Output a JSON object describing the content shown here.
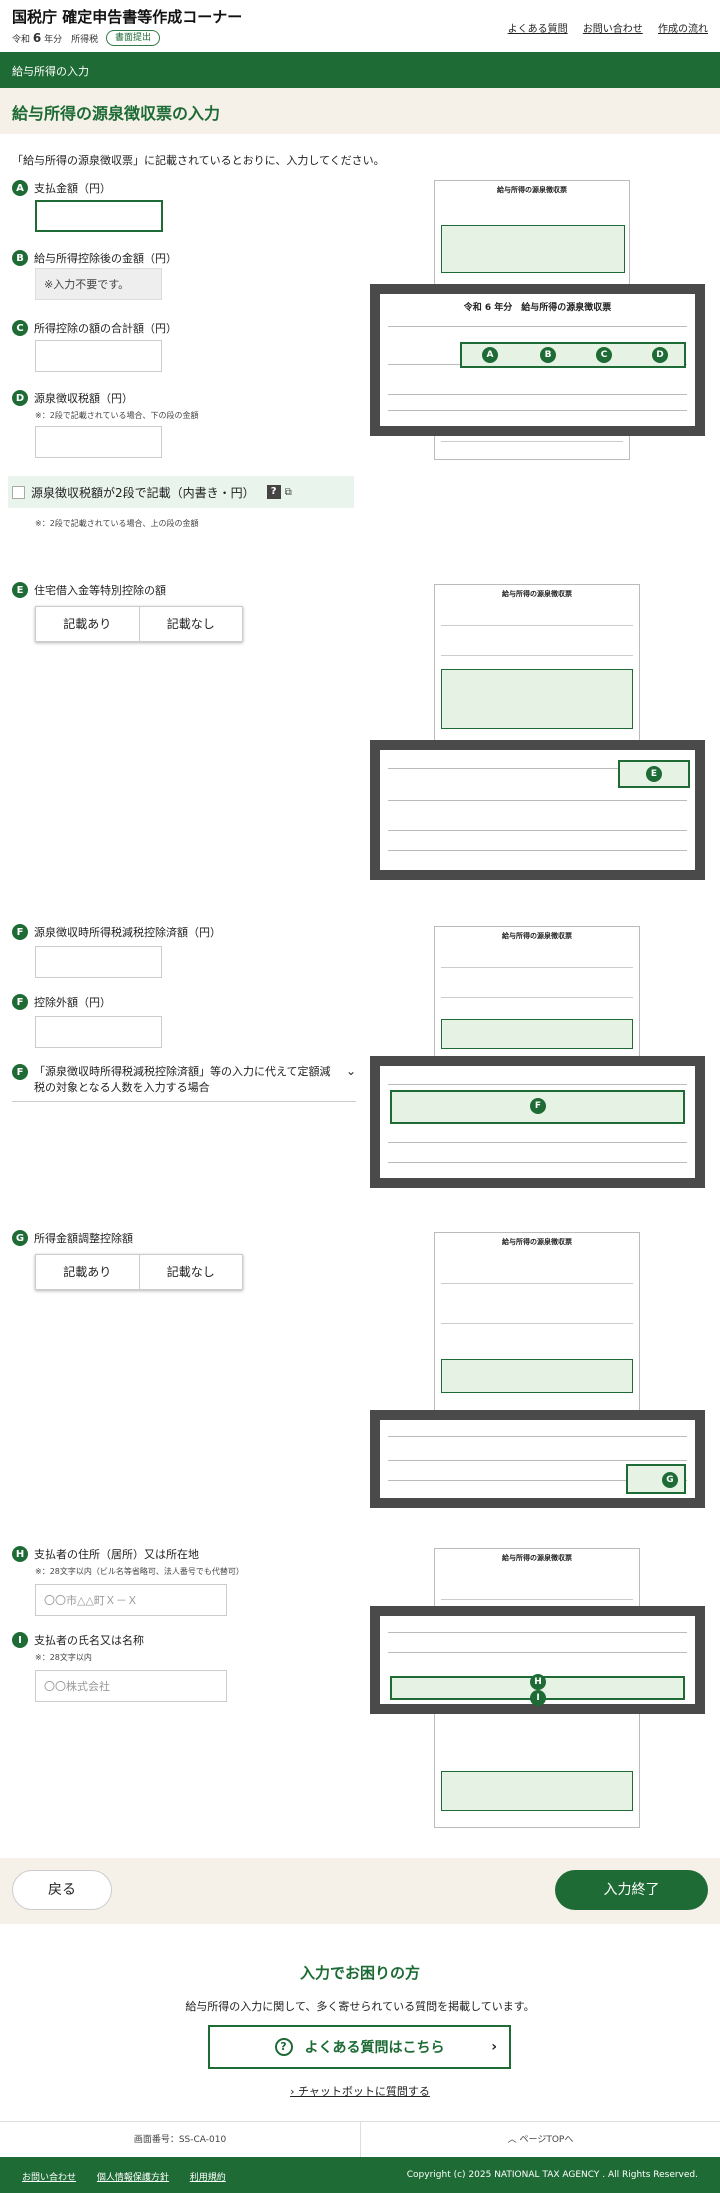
{
  "header": {
    "title": "国税庁 確定申告書等作成コーナー",
    "era": "令和",
    "year": "6",
    "year_suffix": "年分",
    "tax": "所得税",
    "badge": "書面提出",
    "links": [
      "よくある質問",
      "お問い合わせ",
      "作成の流れ"
    ]
  },
  "breadcrumb": "給与所得の入力",
  "page_title": "給与所得の源泉徴収票の入力",
  "intro": "「給与所得の源泉徴収票」に記載されているとおりに、入力してください。",
  "fields": {
    "a_label": "支払金額（円）",
    "b_label": "給与所得控除後の金額（円）",
    "b_value": "※入力不要です。",
    "c_label": "所得控除の額の合計額（円）",
    "d_label": "源泉徴収税額（円）",
    "d_note": "※：2段で記載されている場合、下の段の金額",
    "two_row_check": "源泉徴収税額が2段で記載（内書き・円）",
    "two_row_note": "※：2段で記載されている場合、上の段の金額",
    "e_label": "住宅借入金等特別控除の額",
    "f1_label": "源泉徴収時所得税減税控除済額（円）",
    "f2_label": "控除外額（円）",
    "f3_label": "「源泉徴収時所得税減税控除済額」等の入力に代えて定額減税の対象となる人数を入力する場合",
    "g_label": "所得金額調整控除額",
    "h_label": "支払者の住所（居所）又は所在地",
    "h_note": "※：28文字以内（ビル名等省略可、法人番号でも代替可）",
    "h_placeholder": "〇〇市△△町Ｘ－Ｘ",
    "i_label": "支払者の氏名又は名称",
    "i_note": "※：28文字以内",
    "i_placeholder": "〇〇株式会社"
  },
  "choice": {
    "yes": "記載あり",
    "no": "記載なし"
  },
  "markers": [
    "A",
    "B",
    "C",
    "D",
    "E",
    "F",
    "G",
    "H",
    "I"
  ],
  "doc": {
    "title": "給与所得の源泉徴収票",
    "era_line": "令和 6 年分"
  },
  "nav": {
    "back": "戻る",
    "finish": "入力終了"
  },
  "help": {
    "heading": "入力でお困りの方",
    "text": "給与所得の入力に関して、多く寄せられている質問を掲載しています。",
    "faq": "よくある質問はこちら",
    "chat": "チャットボットに質問する"
  },
  "status": {
    "screen_id": "画面番号：SS-CA-010",
    "pagetop": "ページTOPへ"
  },
  "footer": {
    "links": [
      "お問い合わせ",
      "個人情報保護方針",
      "利用規約"
    ],
    "copyright": "Copyright (c) 2025 NATIONAL TAX AGENCY . All Rights Reserved."
  },
  "colors": {
    "brand": "#1e6b35",
    "band": "#f5f1e8",
    "check_bg": "#e8f4ec"
  }
}
